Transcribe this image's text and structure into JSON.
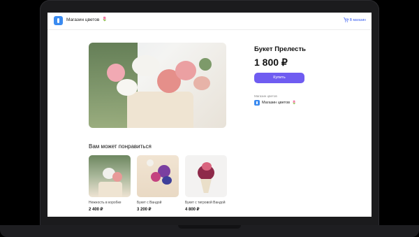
{
  "header": {
    "store_name": "Магазин цветов",
    "store_emoji": "🌷",
    "cart_label": "В магазин"
  },
  "product": {
    "title": "Букет Прелесть",
    "price": "1 800 ₽",
    "buy_label": "Купить",
    "seller_caption": "Магазин цветов",
    "seller_name": "Магазин цветов",
    "seller_emoji": "🌷"
  },
  "recommendations": {
    "title": "Вам может понравиться",
    "items": [
      {
        "name": "Нежность в коробке",
        "price": "2 400 ₽"
      },
      {
        "name": "Букет с Вандой",
        "price": "3 200 ₽"
      },
      {
        "name": "Букет с тигровой Вандой",
        "price": "4 800 ₽"
      }
    ]
  },
  "colors": {
    "accent": "#6f5cf1",
    "logo": "#3b8bf0",
    "link": "#3b5ff0"
  }
}
